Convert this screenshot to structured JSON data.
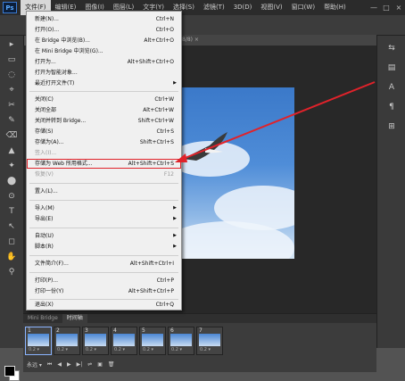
{
  "menubar": {
    "logo": "Ps",
    "items": [
      "文件(F)",
      "编辑(E)",
      "图像(I)",
      "图层(L)",
      "文字(Y)",
      "选择(S)",
      "滤镜(T)",
      "3D(D)",
      "视图(V)",
      "窗口(W)",
      "帮助(H)"
    ],
    "window_buttons": [
      "—",
      "□",
      "×"
    ]
  },
  "document": {
    "tab_label": "8/8) ×"
  },
  "file_menu": {
    "items": [
      {
        "label": "新建(N)...",
        "shortcut": "Ctrl+N"
      },
      {
        "label": "打开(O)...",
        "shortcut": "Ctrl+O"
      },
      {
        "label": "在 Bridge 中浏览(B)...",
        "shortcut": "Alt+Ctrl+O"
      },
      {
        "label": "在 Mini Bridge 中浏览(G)...",
        "shortcut": ""
      },
      {
        "label": "打开为...",
        "shortcut": "Alt+Shift+Ctrl+O"
      },
      {
        "label": "打开为智能对象...",
        "shortcut": ""
      },
      {
        "label": "最近打开文件(T)",
        "shortcut": ""
      },
      {
        "label": "关闭(C)",
        "shortcut": "Ctrl+W"
      },
      {
        "label": "关闭全部",
        "shortcut": "Alt+Ctrl+W"
      },
      {
        "label": "关闭并转到 Bridge...",
        "shortcut": "Shift+Ctrl+W"
      },
      {
        "label": "存储(S)",
        "shortcut": "Ctrl+S"
      },
      {
        "label": "存储为(A)...",
        "shortcut": "Shift+Ctrl+S"
      },
      {
        "label": "签入(I)...",
        "shortcut": ""
      },
      {
        "label": "存储为 Web 所用格式...",
        "shortcut": "Alt+Shift+Ctrl+S"
      },
      {
        "label": "恢复(V)",
        "shortcut": "F12"
      },
      {
        "label": "置入(L)...",
        "shortcut": ""
      },
      {
        "label": "导入(M)",
        "shortcut": ""
      },
      {
        "label": "导出(E)",
        "shortcut": ""
      },
      {
        "label": "自动(U)",
        "shortcut": ""
      },
      {
        "label": "脚本(R)",
        "shortcut": ""
      },
      {
        "label": "文件简介(F)...",
        "shortcut": "Alt+Shift+Ctrl+I"
      },
      {
        "label": "打印(P)...",
        "shortcut": "Ctrl+P"
      },
      {
        "label": "打印一份(Y)",
        "shortcut": "Alt+Shift+Ctrl+P"
      },
      {
        "label": "退出(X)",
        "shortcut": "Ctrl+Q"
      }
    ]
  },
  "timeline": {
    "tabs": [
      "Mini Bridge",
      "时间轴"
    ],
    "frames": [
      {
        "num": "1",
        "delay": "0.2 ▾"
      },
      {
        "num": "2",
        "delay": "0.2 ▾"
      },
      {
        "num": "3",
        "delay": "0.2 ▾"
      },
      {
        "num": "4",
        "delay": "0.2 ▾"
      },
      {
        "num": "5",
        "delay": "0.2 ▾"
      },
      {
        "num": "6",
        "delay": "0.2 ▾"
      },
      {
        "num": "7",
        "delay": "0.2 ▾"
      }
    ],
    "loop_label": "永远 ▾",
    "controls": [
      "⏮",
      "◀",
      "▶",
      "▶|",
      "⇌",
      "▣",
      "🗑"
    ]
  },
  "tools": [
    "▸",
    "▭",
    "◌",
    "⌖",
    "✂",
    "✎",
    "⌫",
    "▲",
    "✦",
    "⬤",
    "⊙",
    "T",
    "↖",
    "◻",
    "✋",
    "⚲"
  ],
  "right_panel": [
    "⇆",
    "▤",
    "A",
    "¶",
    "⊞"
  ],
  "colors": {
    "highlight": "#e0222a",
    "arrow": "#e0222a"
  }
}
